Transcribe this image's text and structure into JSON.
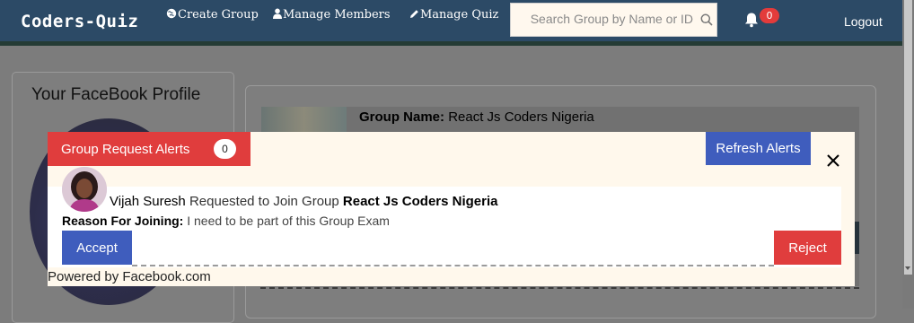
{
  "navbar": {
    "brand": "Coders-Quiz",
    "links": [
      {
        "label": "Create Group",
        "icon": "globe-icon"
      },
      {
        "label": "Manage Members",
        "icon": "user-icon"
      },
      {
        "label": "Manage Quiz",
        "icon": "pencil-icon"
      }
    ],
    "search": {
      "placeholder": "Search Group by Name or ID",
      "icon": "search-icon"
    },
    "notifications": {
      "icon": "bell-icon",
      "count": "0"
    },
    "logout_label": "Logout"
  },
  "profile": {
    "title": "Your FaceBook Profile"
  },
  "group": {
    "name_label": "Group Name:",
    "name_value": "React Js Coders Nigeria"
  },
  "alerts_modal": {
    "title": "Group Request Alerts",
    "count": "0",
    "refresh_label": "Refresh Alerts",
    "close_icon": "close-icon",
    "request": {
      "user_name": "Vijah Suresh",
      "action_text": "Requested to Join Group",
      "group_name": "React Js Coders Nigeria",
      "reason_label": "Reason For Joining:",
      "reason_text": "I need to be part of this Group Exam",
      "accept_label": "Accept",
      "reject_label": "Reject"
    },
    "footer": "Powered by Facebook.com"
  },
  "colors": {
    "navbar": "#2c4a66",
    "accent_red": "#e03d3d",
    "accent_blue": "#3f5dbd",
    "modal_bg": "#fff8ec"
  }
}
